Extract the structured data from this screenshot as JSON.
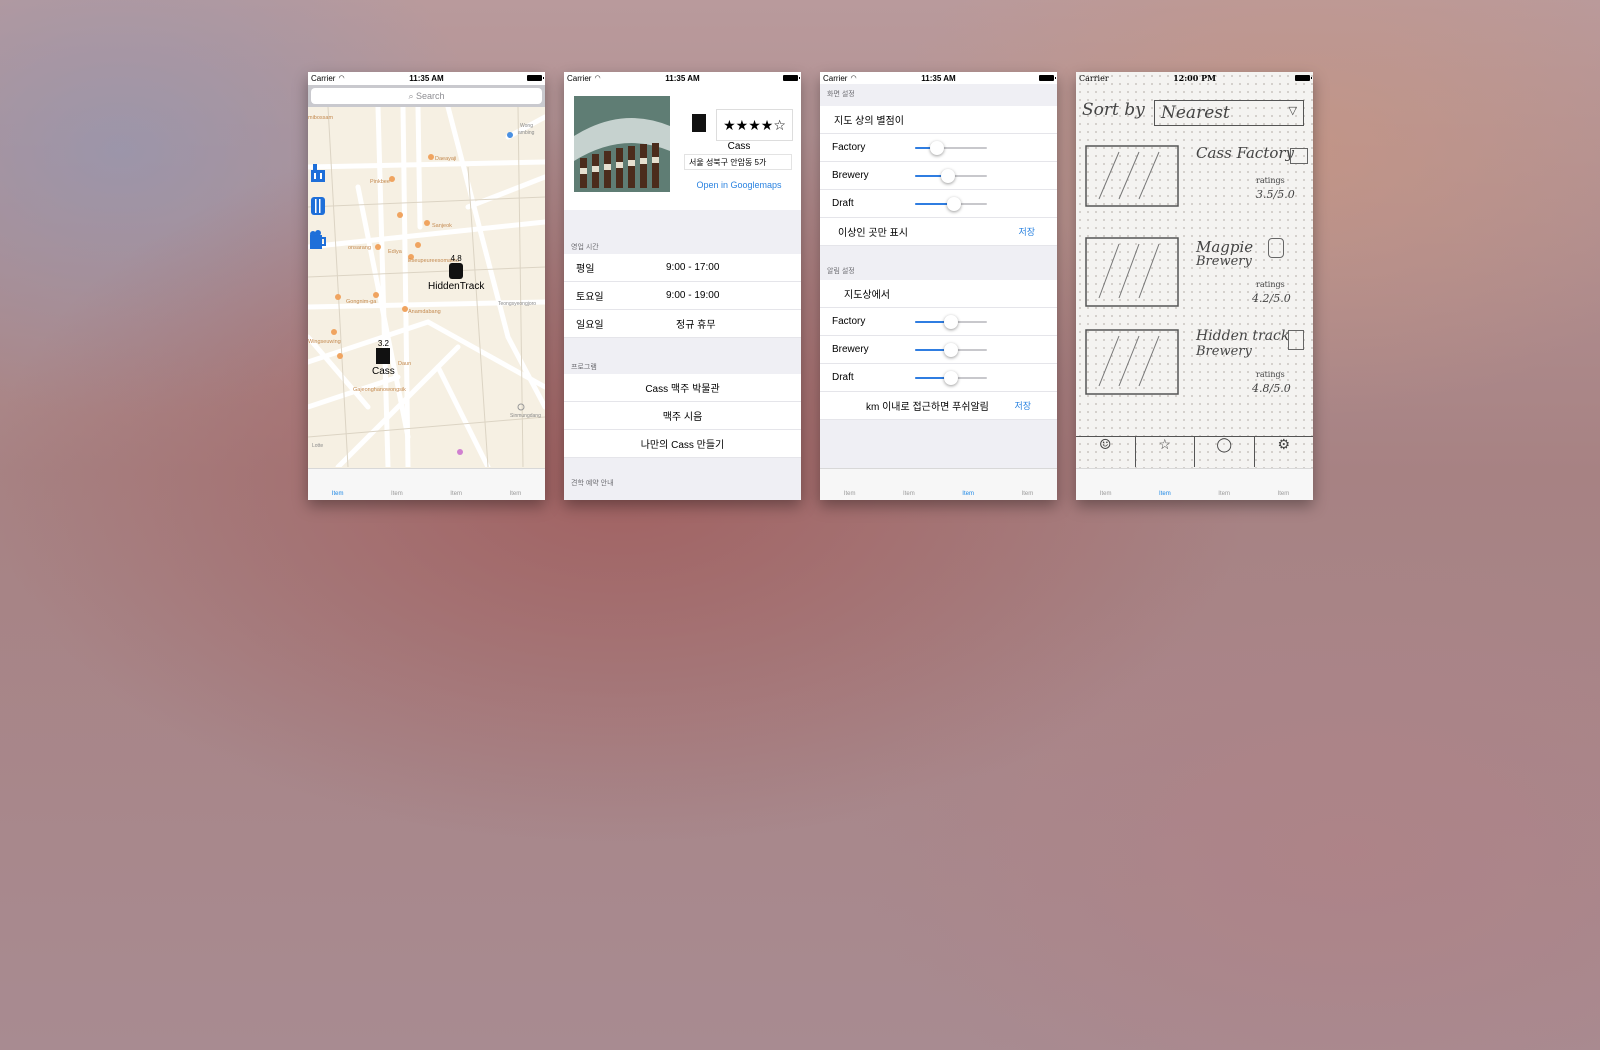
{
  "status": {
    "carrier": "Carrier",
    "time": "11:35 AM"
  },
  "screen4_status": {
    "carrier": "Carrier",
    "time": "12:00 PM"
  },
  "tabs": [
    "Item",
    "Item",
    "Item",
    "Item"
  ],
  "map_screen": {
    "search_placeholder": "Search",
    "pins": [
      {
        "rating": "4.8",
        "name": "HiddenTrack"
      },
      {
        "rating": "3.2",
        "name": "Cass"
      }
    ],
    "street_labels": [
      "mibossam",
      "Daeayaji",
      "Pinkbee",
      "Sanjeok",
      "Ediya",
      "Eseupeureesomaetu",
      "onsarang",
      "Gongnim-ga",
      "Anamdabang",
      "Wingseuwing",
      "Daun",
      "Gajeonghanowongsik",
      "Seongmuadan",
      "Wong ambing",
      "Teongsyeongjoro",
      "Sinmungdang",
      "Lotte"
    ]
  },
  "detail_screen": {
    "stars": "★★★★☆",
    "brewery_name": "Cass",
    "address": "서울 성북구 안암동 5가",
    "open_maps": "Open in Googlemaps",
    "hours_header": "영업 시간",
    "hours": [
      {
        "day": "평일",
        "time": "9:00 - 17:00"
      },
      {
        "day": "토요일",
        "time": "9:00 - 19:00"
      },
      {
        "day": "일요일",
        "time": "정규 휴무"
      }
    ],
    "program_header": "프로그램",
    "programs": [
      "Cass 맥주 박물관",
      "맥주 시음",
      "나만의 Cass 만들기"
    ],
    "tour_header": "견학 예약 안내"
  },
  "settings_screen": {
    "display_header": "화면 설정",
    "display_title": "지도 상의 별점이",
    "display_sliders": [
      {
        "label": "Factory",
        "value": 0.25
      },
      {
        "label": "Brewery",
        "value": 0.45
      },
      {
        "label": "Draft",
        "value": 0.55
      }
    ],
    "display_footer": "이상인 곳만 표시",
    "save": "저장",
    "alert_header": "알림 설정",
    "alert_title": "지도상에서",
    "alert_sliders": [
      {
        "label": "Factory",
        "value": 0.5
      },
      {
        "label": "Brewery",
        "value": 0.5
      },
      {
        "label": "Draft",
        "value": 0.5
      }
    ],
    "alert_footer": "km 이내로 접근하면 푸쉬알림"
  },
  "sketch_screen": {
    "sort_label": "Sort by",
    "sort_value": "Nearest",
    "items": [
      {
        "name": "Cass Factory",
        "sub": "",
        "rating": "3.5/5.0"
      },
      {
        "name": "Magpie",
        "sub": "Brewery",
        "rating": "4.2/5.0"
      },
      {
        "name": "Hidden track",
        "sub": "Brewery",
        "rating": "4.8/5.0"
      }
    ],
    "ratings_label": "ratings"
  },
  "colors": {
    "accent": "#2b83e0",
    "map_bg": "#f6f0e3"
  }
}
